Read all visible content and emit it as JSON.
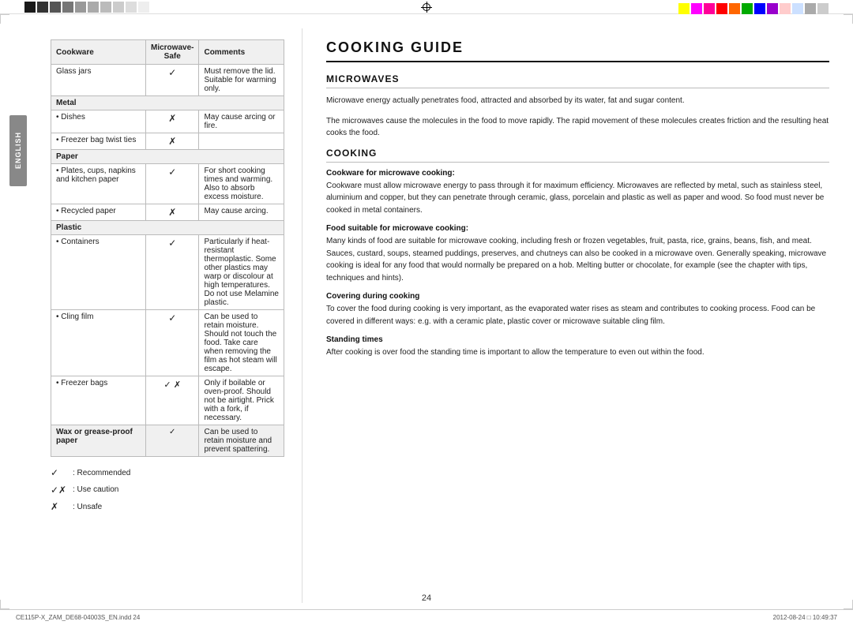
{
  "topBar": {
    "swatchesLeft": [
      "#1a1a1a",
      "#333",
      "#555",
      "#777",
      "#999",
      "#aaa",
      "#bbb",
      "#ccc",
      "#ddd",
      "#eee",
      "#fff"
    ],
    "swatchesRight": [
      "#ffff00",
      "#ff00ff",
      "#ff0099",
      "#ff0000",
      "#ff6600",
      "#00aa00",
      "#0000ff",
      "#9900cc",
      "#ffcccc",
      "#cce0ff",
      "#aaaaaa",
      "#cccccc"
    ]
  },
  "page": {
    "number": "24"
  },
  "footer": {
    "left": "CE115P-X_ZAM_DE68-04003S_EN.indd  24",
    "right": "2012-08-24  □ 10:49:37"
  },
  "sideTab": {
    "label": "ENGLISH"
  },
  "table": {
    "headers": [
      "Cookware",
      "Microwave-\nSafe",
      "Comments"
    ],
    "rows": [
      {
        "type": "item",
        "cookware": "Glass jars",
        "safe": "✓",
        "comment": "Must remove the lid. Suitable for warming only."
      },
      {
        "type": "category",
        "cookware": "Metal",
        "safe": "",
        "comment": ""
      },
      {
        "type": "item",
        "cookware": "• Dishes",
        "safe": "✗",
        "comment": "May cause arcing or fire."
      },
      {
        "type": "item",
        "cookware": "• Freezer bag twist ties",
        "safe": "✗",
        "comment": ""
      },
      {
        "type": "category",
        "cookware": "Paper",
        "safe": "",
        "comment": ""
      },
      {
        "type": "item",
        "cookware": "• Plates, cups, napkins and kitchen paper",
        "safe": "✓",
        "comment": "For short cooking times and warming. Also to absorb excess moisture."
      },
      {
        "type": "item",
        "cookware": "• Recycled paper",
        "safe": "✗",
        "comment": "May cause arcing."
      },
      {
        "type": "category",
        "cookware": "Plastic",
        "safe": "",
        "comment": ""
      },
      {
        "type": "item",
        "cookware": "• Containers",
        "safe": "✓",
        "comment": "Particularly if heat-resistant thermoplastic. Some other plastics may warp or discolour at high temperatures. Do not use Melamine plastic."
      },
      {
        "type": "item",
        "cookware": "• Cling film",
        "safe": "✓",
        "comment": "Can be used to retain moisture. Should not touch the food. Take care when removing the film as hot steam will escape."
      },
      {
        "type": "item",
        "cookware": "• Freezer bags",
        "safe": "✓✗",
        "comment": "Only if boilable or oven-proof. Should not be airtight. Prick with a fork, if necessary."
      },
      {
        "type": "category",
        "cookware": "Wax or grease-proof paper",
        "safe": "✓",
        "comment": "Can be used to retain moisture and prevent spattering."
      }
    ],
    "legend": [
      {
        "symbol": "✓",
        "text": ": Recommended"
      },
      {
        "symbol": "✓✗",
        "text": ": Use caution"
      },
      {
        "symbol": "✗",
        "text": ": Unsafe"
      }
    ]
  },
  "guide": {
    "title": "COOKING GUIDE",
    "sections": [
      {
        "title": "MICROWAVES",
        "paragraphs": [
          "Microwave energy actually penetrates food, attracted and absorbed by its water, fat and sugar content.",
          "The microwaves cause the molecules in the food to move rapidly. The rapid movement of these molecules creates friction and the resulting heat cooks the food."
        ]
      },
      {
        "title": "COOKING",
        "subsections": [
          {
            "title": "Cookware for microwave cooking:",
            "text": "Cookware must allow microwave energy to pass through it for maximum efficiency. Microwaves are reflected by metal, such as stainless steel, aluminium and copper, but they can penetrate through ceramic, glass, porcelain and plastic as well as paper and wood. So food must never be cooked in metal containers."
          },
          {
            "title": "Food suitable for microwave cooking:",
            "text": "Many kinds of food are suitable for microwave cooking, including fresh or frozen vegetables, fruit, pasta, rice, grains, beans, fish, and meat. Sauces, custard, soups, steamed puddings, preserves, and chutneys can also be cooked in a microwave oven. Generally speaking, microwave cooking is ideal for any food that would normally be prepared on a hob. Melting butter or chocolate, for example (see the chapter with tips, techniques and hints)."
          },
          {
            "title": "Covering during cooking",
            "text": "To cover the food during cooking is very important, as the evaporated water rises as steam and contributes to cooking process. Food can be covered in different ways: e.g. with a ceramic plate, plastic cover or microwave suitable cling film."
          },
          {
            "title": "Standing times",
            "text": "After cooking is over food the standing time is important to allow the temperature to even out within the food."
          }
        ]
      }
    ]
  }
}
